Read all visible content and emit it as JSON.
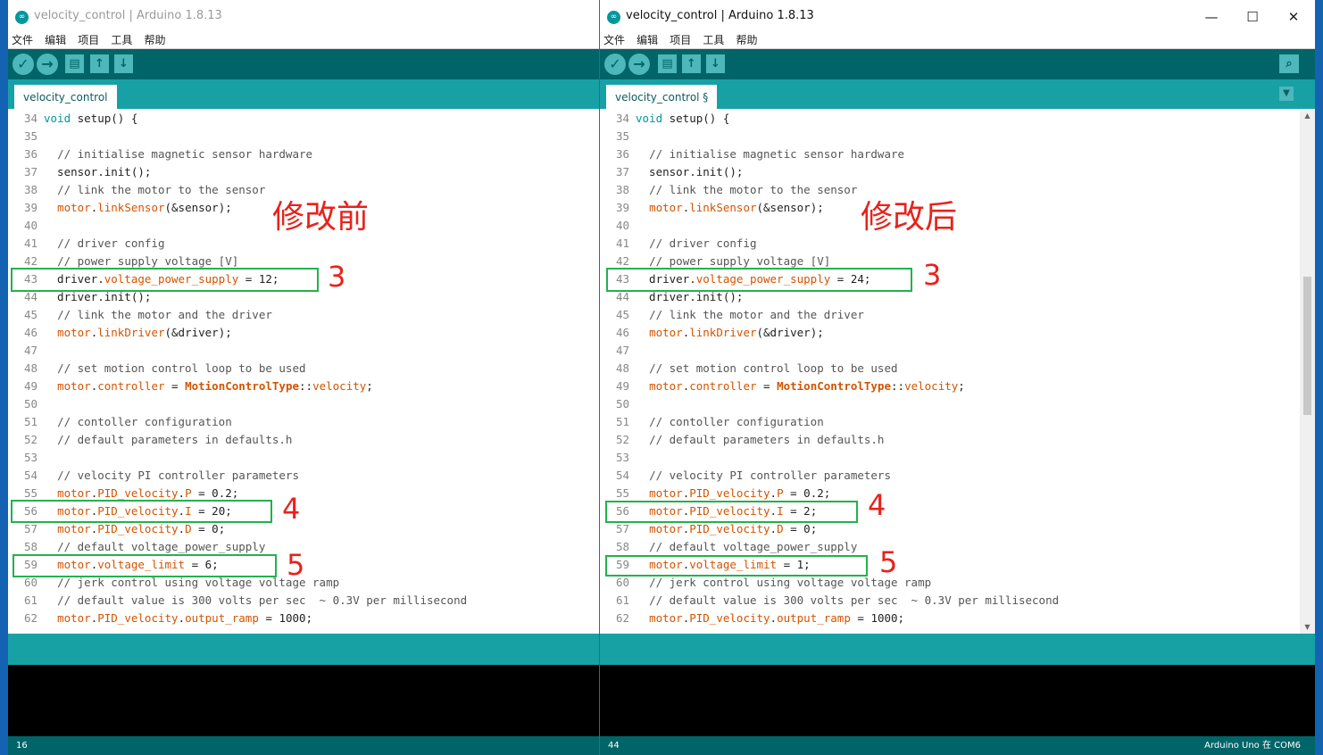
{
  "left_window": {
    "title": "velocity_control | Arduino 1.8.13",
    "menu": [
      "文件",
      "编辑",
      "项目",
      "工具",
      "帮助"
    ],
    "tab_label": "velocity_control",
    "status_line": "16",
    "annotation_label": "修改前"
  },
  "right_window": {
    "title": "velocity_control | Arduino 1.8.13",
    "menu": [
      "文件",
      "编辑",
      "项目",
      "工具",
      "帮助"
    ],
    "tab_label": "velocity_control §",
    "status_line": "44",
    "board": "Arduino Uno 在 COM6",
    "annotation_label": "修改后",
    "controls": {
      "minimize": "—",
      "maximize": "☐",
      "close": "✕"
    }
  },
  "toolbar_icons": [
    "verify-icon",
    "upload-icon",
    "new-icon",
    "open-icon",
    "save-icon",
    "serial-monitor-icon"
  ],
  "code_left": [
    {
      "n": "34",
      "t": "void setup() {"
    },
    {
      "n": "35",
      "t": ""
    },
    {
      "n": "36",
      "t": "  // initialise magnetic sensor hardware"
    },
    {
      "n": "37",
      "t": "  sensor.init();"
    },
    {
      "n": "38",
      "t": "  // link the motor to the sensor"
    },
    {
      "n": "39",
      "t": "  motor.linkSensor(&sensor);"
    },
    {
      "n": "40",
      "t": ""
    },
    {
      "n": "41",
      "t": "  // driver config"
    },
    {
      "n": "42",
      "t": "  // power supply voltage [V]"
    },
    {
      "n": "43",
      "t": "  driver.voltage_power_supply = 12;"
    },
    {
      "n": "44",
      "t": "  driver.init();"
    },
    {
      "n": "45",
      "t": "  // link the motor and the driver"
    },
    {
      "n": "46",
      "t": "  motor.linkDriver(&driver);"
    },
    {
      "n": "47",
      "t": ""
    },
    {
      "n": "48",
      "t": "  // set motion control loop to be used"
    },
    {
      "n": "49",
      "t": "  motor.controller = MotionControlType::velocity;"
    },
    {
      "n": "50",
      "t": ""
    },
    {
      "n": "51",
      "t": "  // contoller configuration"
    },
    {
      "n": "52",
      "t": "  // default parameters in defaults.h"
    },
    {
      "n": "53",
      "t": ""
    },
    {
      "n": "54",
      "t": "  // velocity PI controller parameters"
    },
    {
      "n": "55",
      "t": "  motor.PID_velocity.P = 0.2;"
    },
    {
      "n": "56",
      "t": "  motor.PID_velocity.I = 20;"
    },
    {
      "n": "57",
      "t": "  motor.PID_velocity.D = 0;"
    },
    {
      "n": "58",
      "t": "  // default voltage_power_supply"
    },
    {
      "n": "59",
      "t": "  motor.voltage_limit = 6;"
    },
    {
      "n": "60",
      "t": "  // jerk control using voltage voltage ramp"
    },
    {
      "n": "61",
      "t": "  // default value is 300 volts per sec  ~ 0.3V per millisecond"
    },
    {
      "n": "62",
      "t": "  motor.PID_velocity.output_ramp = 1000;"
    }
  ],
  "code_right": [
    {
      "n": "34",
      "t": "void setup() {"
    },
    {
      "n": "35",
      "t": ""
    },
    {
      "n": "36",
      "t": "  // initialise magnetic sensor hardware"
    },
    {
      "n": "37",
      "t": "  sensor.init();"
    },
    {
      "n": "38",
      "t": "  // link the motor to the sensor"
    },
    {
      "n": "39",
      "t": "  motor.linkSensor(&sensor);"
    },
    {
      "n": "40",
      "t": ""
    },
    {
      "n": "41",
      "t": "  // driver config"
    },
    {
      "n": "42",
      "t": "  // power supply voltage [V]"
    },
    {
      "n": "43",
      "t": "  driver.voltage_power_supply = 24;"
    },
    {
      "n": "44",
      "t": "  driver.init();"
    },
    {
      "n": "45",
      "t": "  // link the motor and the driver"
    },
    {
      "n": "46",
      "t": "  motor.linkDriver(&driver);"
    },
    {
      "n": "47",
      "t": ""
    },
    {
      "n": "48",
      "t": "  // set motion control loop to be used"
    },
    {
      "n": "49",
      "t": "  motor.controller = MotionControlType::velocity;"
    },
    {
      "n": "50",
      "t": ""
    },
    {
      "n": "51",
      "t": "  // contoller configuration"
    },
    {
      "n": "52",
      "t": "  // default parameters in defaults.h"
    },
    {
      "n": "53",
      "t": ""
    },
    {
      "n": "54",
      "t": "  // velocity PI controller parameters"
    },
    {
      "n": "55",
      "t": "  motor.PID_velocity.P = 0.2;"
    },
    {
      "n": "56",
      "t": "  motor.PID_velocity.I = 2;"
    },
    {
      "n": "57",
      "t": "  motor.PID_velocity.D = 0;"
    },
    {
      "n": "58",
      "t": "  // default voltage_power_supply"
    },
    {
      "n": "59",
      "t": "  motor.voltage_limit = 1;"
    },
    {
      "n": "60",
      "t": "  // jerk control using voltage voltage ramp"
    },
    {
      "n": "61",
      "t": "  // default value is 300 volts per sec  ~ 0.3V per millisecond"
    },
    {
      "n": "62",
      "t": "  motor.PID_velocity.output_ramp = 1000;"
    }
  ],
  "annotations": {
    "n3": "3",
    "n4": "4",
    "n5": "5"
  },
  "colors": {
    "toolbar": "#006468",
    "tabbar": "#17a1a5",
    "highlight_box": "#22b24c",
    "annotation_text": "#e8221b",
    "keyword_orange": "#d35400",
    "type_teal": "#00979c"
  }
}
